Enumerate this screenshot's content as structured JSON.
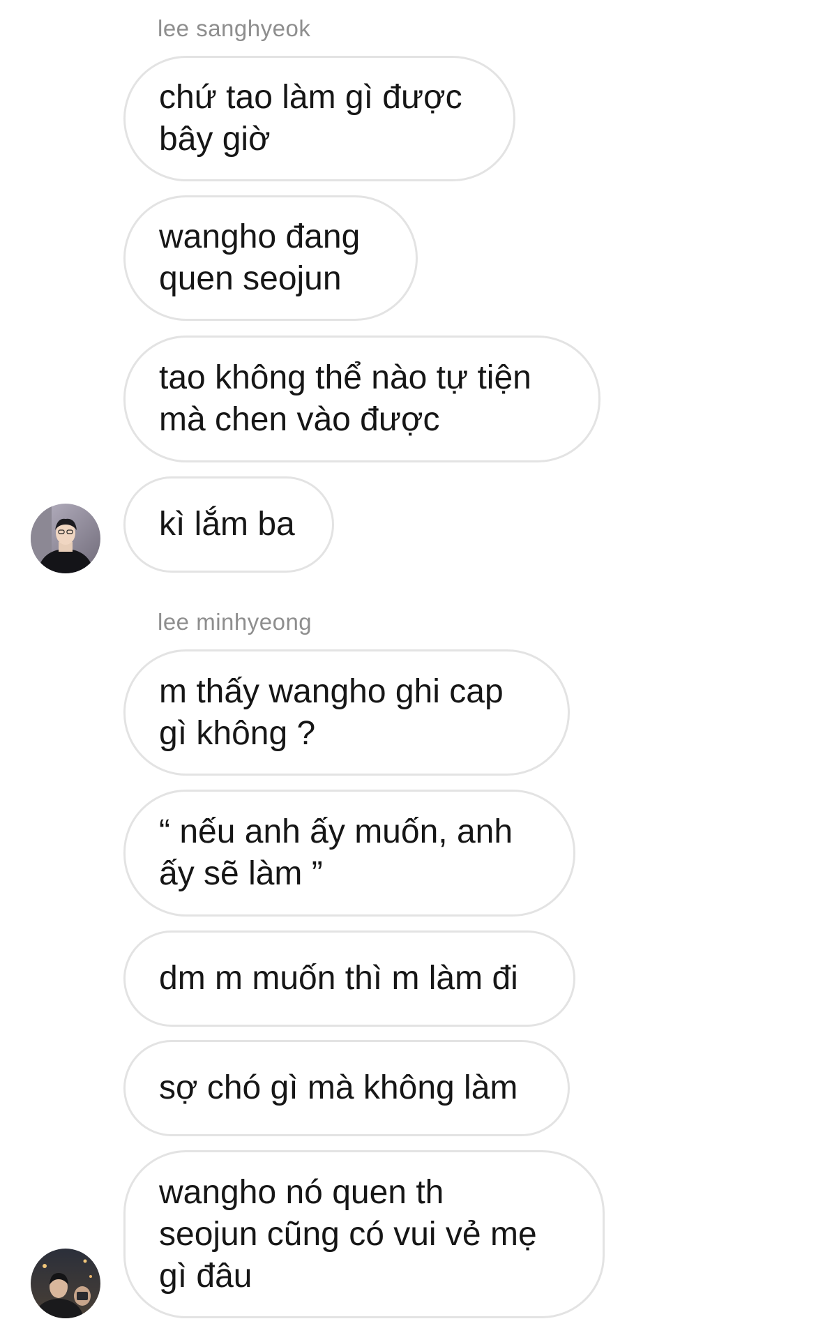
{
  "groups": [
    {
      "sender": "lee sanghyeok",
      "avatar_icon": "user-avatar-1",
      "messages": [
        "chứ tao làm gì được\nbây giờ",
        "wangho đang\nquen seojun",
        "tao không thể nào tự tiện\nmà chen vào được",
        "kì lắm ba"
      ]
    },
    {
      "sender": "lee minhyeong",
      "avatar_icon": "user-avatar-2",
      "messages": [
        "m thấy wangho ghi cap\ngì không ?",
        "“ nếu anh ấy muốn, anh\nấy sẽ làm ”",
        "dm m muốn thì m làm đi",
        "sợ chó gì mà không làm",
        "wangho nó quen th\nseojun cũng có vui vẻ mẹ\ngì đâu"
      ]
    }
  ],
  "colors": {
    "background": "#ffffff",
    "bubble_border": "#e3e3e3",
    "sender_text": "#8e8e8e",
    "message_text": "#161616"
  }
}
